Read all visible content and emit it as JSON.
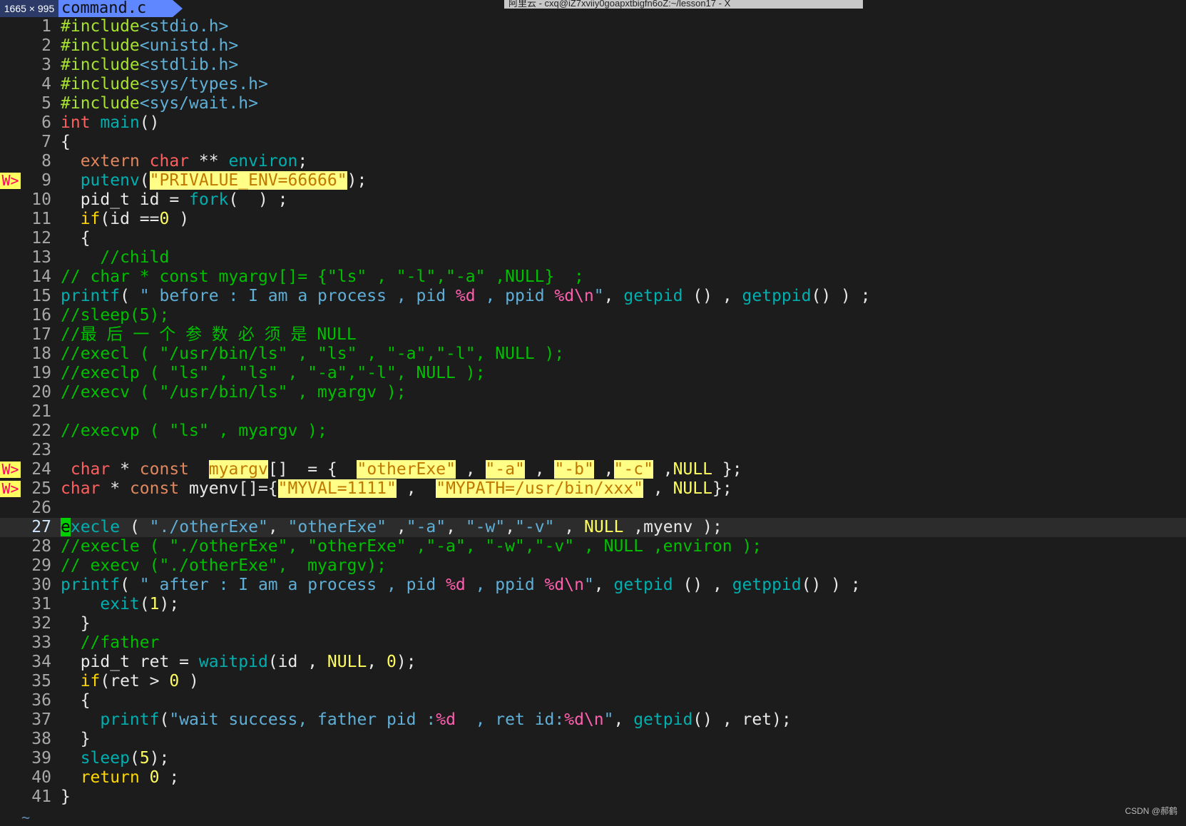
{
  "overlay": {
    "dimensions": "1665 × 995"
  },
  "tab": {
    "filename": "command.c"
  },
  "window_title": "阿里云 - cxq@iZ7xviiy0goapxtbigfn6oZ:~/lesson17 - X",
  "sign_text": "W>",
  "cursor_line": 27,
  "tilde": "~",
  "watermark": "CSDN @郝鹤",
  "colors": {
    "background": "#1c1c1c",
    "tab": "#5f87ff",
    "highlight": "#ffff87",
    "sign": "#ffff5f"
  },
  "lines": [
    {
      "n": 1,
      "t": [
        [
          "pp",
          "#include"
        ],
        [
          "hd",
          "<stdio.h>"
        ]
      ]
    },
    {
      "n": 2,
      "t": [
        [
          "pp",
          "#include"
        ],
        [
          "hd",
          "<unistd.h>"
        ]
      ]
    },
    {
      "n": 3,
      "t": [
        [
          "pp",
          "#include"
        ],
        [
          "hd",
          "<stdlib.h>"
        ]
      ]
    },
    {
      "n": 4,
      "t": [
        [
          "pp",
          "#include"
        ],
        [
          "hd",
          "<sys/types.h>"
        ]
      ]
    },
    {
      "n": 5,
      "t": [
        [
          "pp",
          "#include"
        ],
        [
          "hd",
          "<sys/wait.h>"
        ]
      ]
    },
    {
      "n": 6,
      "t": [
        [
          "kw",
          "int"
        ],
        [
          "tx",
          " "
        ],
        [
          "fn",
          "main"
        ],
        [
          "tx",
          "()"
        ]
      ]
    },
    {
      "n": 7,
      "t": [
        [
          "tx",
          "{"
        ]
      ]
    },
    {
      "n": 8,
      "t": [
        [
          "tx",
          "  "
        ],
        [
          "ty",
          "extern"
        ],
        [
          "tx",
          " "
        ],
        [
          "kw",
          "char"
        ],
        [
          "tx",
          " ** "
        ],
        [
          "fn",
          "environ"
        ],
        [
          "tx",
          ";"
        ]
      ]
    },
    {
      "n": 9,
      "sign": true,
      "t": [
        [
          "tx",
          "  "
        ],
        [
          "fn",
          "putenv"
        ],
        [
          "tx",
          "("
        ],
        [
          "hl",
          "\"PRIVALUE_ENV=66666\""
        ],
        [
          "tx",
          ");"
        ]
      ]
    },
    {
      "n": 10,
      "t": [
        [
          "tx",
          "  pid_t id = "
        ],
        [
          "fn",
          "fork"
        ],
        [
          "tx",
          "(  ) ;"
        ]
      ]
    },
    {
      "n": 11,
      "t": [
        [
          "tx",
          "  "
        ],
        [
          "ctl",
          "if"
        ],
        [
          "tx",
          "(id =="
        ],
        [
          "nl",
          "0"
        ],
        [
          "tx",
          " )"
        ]
      ]
    },
    {
      "n": 12,
      "t": [
        [
          "tx",
          "  {"
        ]
      ]
    },
    {
      "n": 13,
      "t": [
        [
          "cm",
          "    //child"
        ]
      ]
    },
    {
      "n": 14,
      "t": [
        [
          "cm",
          "// char * const myargv[]= {\"ls\" , \"-l\",\"-a\" ,NULL}  ;"
        ]
      ]
    },
    {
      "n": 15,
      "t": [
        [
          "fn",
          "printf"
        ],
        [
          "tx",
          "( "
        ],
        [
          "st",
          "\" before : I am a process , pid "
        ],
        [
          "fmt",
          "%d"
        ],
        [
          "st",
          " , ppid "
        ],
        [
          "fmt",
          "%d\\n"
        ],
        [
          "st",
          "\""
        ],
        [
          "tx",
          ", "
        ],
        [
          "fn",
          "getpid"
        ],
        [
          "tx",
          " () , "
        ],
        [
          "fn",
          "getppid"
        ],
        [
          "tx",
          "() ) ;"
        ]
      ]
    },
    {
      "n": 16,
      "t": [
        [
          "cm",
          "//sleep(5);"
        ]
      ]
    },
    {
      "n": 17,
      "t": [
        [
          "cm",
          "//最 后 一 个 参 数 必 须 是 NULL"
        ]
      ]
    },
    {
      "n": 18,
      "t": [
        [
          "cm",
          "//execl ( \"/usr/bin/ls\" , \"ls\" , \"-a\",\"-l\", NULL );"
        ]
      ]
    },
    {
      "n": 19,
      "t": [
        [
          "cm",
          "//execlp ( \"ls\" , \"ls\" , \"-a\",\"-l\", NULL );"
        ]
      ]
    },
    {
      "n": 20,
      "t": [
        [
          "cm",
          "//execv ( \"/usr/bin/ls\" , myargv );"
        ]
      ]
    },
    {
      "n": 21,
      "t": []
    },
    {
      "n": 22,
      "t": [
        [
          "cm",
          "//execvp ( \"ls\" , myargv );"
        ]
      ]
    },
    {
      "n": 23,
      "t": []
    },
    {
      "n": 24,
      "sign": true,
      "t": [
        [
          "tx",
          " "
        ],
        [
          "kw",
          "char"
        ],
        [
          "tx",
          " * "
        ],
        [
          "ty",
          "const"
        ],
        [
          "tx",
          "  "
        ],
        [
          "hl",
          "myargv"
        ],
        [
          "tx",
          "[]  = {  "
        ],
        [
          "hl",
          "\"otherExe\""
        ],
        [
          "tx",
          " , "
        ],
        [
          "hl",
          "\"-a\""
        ],
        [
          "tx",
          " , "
        ],
        [
          "hl",
          "\"-b\""
        ],
        [
          "tx",
          " ,"
        ],
        [
          "hl",
          "\"-c\""
        ],
        [
          "tx",
          " ,"
        ],
        [
          "nl",
          "NULL"
        ],
        [
          "tx",
          " };"
        ]
      ]
    },
    {
      "n": 25,
      "sign": true,
      "t": [
        [
          "kw",
          "char"
        ],
        [
          "tx",
          " * "
        ],
        [
          "ty",
          "const"
        ],
        [
          "tx",
          " myenv[]={"
        ],
        [
          "hl",
          "\"MYVAL=1111\""
        ],
        [
          "tx",
          " ,  "
        ],
        [
          "hl",
          "\"MYPATH=/usr/bin/xxx\""
        ],
        [
          "tx",
          " , "
        ],
        [
          "nl",
          "NULL"
        ],
        [
          "tx",
          "};"
        ]
      ]
    },
    {
      "n": 26,
      "t": []
    },
    {
      "n": 27,
      "t": [
        [
          "cursor",
          "e"
        ],
        [
          "fn",
          "xecle"
        ],
        [
          "tx",
          " ( "
        ],
        [
          "st",
          "\"./otherExe\""
        ],
        [
          "tx",
          ", "
        ],
        [
          "st",
          "\"otherExe\""
        ],
        [
          "tx",
          " ,"
        ],
        [
          "st",
          "\"-a\""
        ],
        [
          "tx",
          ", "
        ],
        [
          "st",
          "\"-w\""
        ],
        [
          "tx",
          ","
        ],
        [
          "st",
          "\"-v\""
        ],
        [
          "tx",
          " , "
        ],
        [
          "nl",
          "NULL"
        ],
        [
          "tx",
          " ,myenv );"
        ]
      ]
    },
    {
      "n": 28,
      "t": [
        [
          "cm",
          "//execle ( \"./otherExe\", \"otherExe\" ,\"-a\", \"-w\",\"-v\" , NULL ,environ );"
        ]
      ]
    },
    {
      "n": 29,
      "t": [
        [
          "cm",
          "// execv (\"./otherExe\",  myargv);"
        ]
      ]
    },
    {
      "n": 30,
      "t": [
        [
          "fn",
          "printf"
        ],
        [
          "tx",
          "( "
        ],
        [
          "st",
          "\" after : I am a process , pid "
        ],
        [
          "fmt",
          "%d"
        ],
        [
          "st",
          " , ppid "
        ],
        [
          "fmt",
          "%d\\n"
        ],
        [
          "st",
          "\""
        ],
        [
          "tx",
          ", "
        ],
        [
          "fn",
          "getpid"
        ],
        [
          "tx",
          " () , "
        ],
        [
          "fn",
          "getppid"
        ],
        [
          "tx",
          "() ) ;"
        ]
      ]
    },
    {
      "n": 31,
      "t": [
        [
          "tx",
          "    "
        ],
        [
          "fn",
          "exit"
        ],
        [
          "tx",
          "("
        ],
        [
          "nl",
          "1"
        ],
        [
          "tx",
          ");"
        ]
      ]
    },
    {
      "n": 32,
      "t": [
        [
          "tx",
          "  }"
        ]
      ]
    },
    {
      "n": 33,
      "t": [
        [
          "cm",
          "  //father"
        ]
      ]
    },
    {
      "n": 34,
      "t": [
        [
          "tx",
          "  pid_t ret = "
        ],
        [
          "fn",
          "waitpid"
        ],
        [
          "tx",
          "(id , "
        ],
        [
          "nl",
          "NULL"
        ],
        [
          "tx",
          ", "
        ],
        [
          "nl",
          "0"
        ],
        [
          "tx",
          ");"
        ]
      ]
    },
    {
      "n": 35,
      "t": [
        [
          "tx",
          "  "
        ],
        [
          "ctl",
          "if"
        ],
        [
          "tx",
          "(ret > "
        ],
        [
          "nl",
          "0"
        ],
        [
          "tx",
          " )"
        ]
      ]
    },
    {
      "n": 36,
      "t": [
        [
          "tx",
          "  {"
        ]
      ]
    },
    {
      "n": 37,
      "t": [
        [
          "tx",
          "    "
        ],
        [
          "fn",
          "printf"
        ],
        [
          "tx",
          "("
        ],
        [
          "st",
          "\"wait success, father pid :"
        ],
        [
          "fmt",
          "%d"
        ],
        [
          "st",
          "  , ret id:"
        ],
        [
          "fmt",
          "%d\\n"
        ],
        [
          "st",
          "\""
        ],
        [
          "tx",
          ", "
        ],
        [
          "fn",
          "getpid"
        ],
        [
          "tx",
          "() , ret);"
        ]
      ]
    },
    {
      "n": 38,
      "t": [
        [
          "tx",
          "  }"
        ]
      ]
    },
    {
      "n": 39,
      "t": [
        [
          "tx",
          "  "
        ],
        [
          "fn",
          "sleep"
        ],
        [
          "tx",
          "("
        ],
        [
          "nl",
          "5"
        ],
        [
          "tx",
          ");"
        ]
      ]
    },
    {
      "n": 40,
      "t": [
        [
          "tx",
          "  "
        ],
        [
          "ctl",
          "return"
        ],
        [
          "tx",
          " "
        ],
        [
          "nl",
          "0"
        ],
        [
          "tx",
          " ;"
        ]
      ]
    },
    {
      "n": 41,
      "t": [
        [
          "tx",
          "}"
        ]
      ]
    }
  ]
}
